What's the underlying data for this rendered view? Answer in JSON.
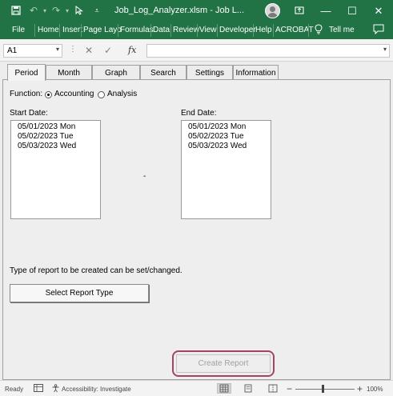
{
  "window": {
    "title": "Job_Log_Analyzer.xlsm  -  Job L...",
    "user_name_blurred": "",
    "controls": [
      "—",
      "☐",
      "✕"
    ]
  },
  "ribbon": {
    "tabs": [
      "File",
      "Home",
      "Insert",
      "Page Layo",
      "Formulas",
      "Data",
      "Review",
      "View",
      "Developer",
      "Help",
      "ACROBAT",
      "Tell me"
    ]
  },
  "formula_bar": {
    "name_box": "A1",
    "formula": "",
    "fx": "fx"
  },
  "form": {
    "tabs": [
      "Period",
      "Month",
      "Graph",
      "Search",
      "Settings",
      "Information"
    ],
    "active_tab": "Period",
    "function_label": "Function:",
    "function_options": [
      "Accounting",
      "Analysis"
    ],
    "function_selected": "Accounting",
    "start_date_label": "Start Date:",
    "start_dates": [
      "05/01/2023 Mon",
      "05/02/2023 Tue",
      "05/03/2023 Wed"
    ],
    "end_date_label": "End Date:",
    "end_dates": [
      "05/01/2023 Mon",
      "05/02/2023 Tue",
      "05/03/2023 Wed"
    ],
    "range_separator": "-",
    "report_note": "Type of report to be created can be set/changed.",
    "select_report_button": "Select Report Type",
    "create_report_button": "Create Report"
  },
  "status_bar": {
    "status": "Ready",
    "accessibility": "Accessibility: Investigate",
    "zoom": "100%",
    "zoom_minus": "−",
    "zoom_plus": "+"
  },
  "colors": {
    "title_bar": "#217346",
    "highlight_ring": "#a24468"
  }
}
